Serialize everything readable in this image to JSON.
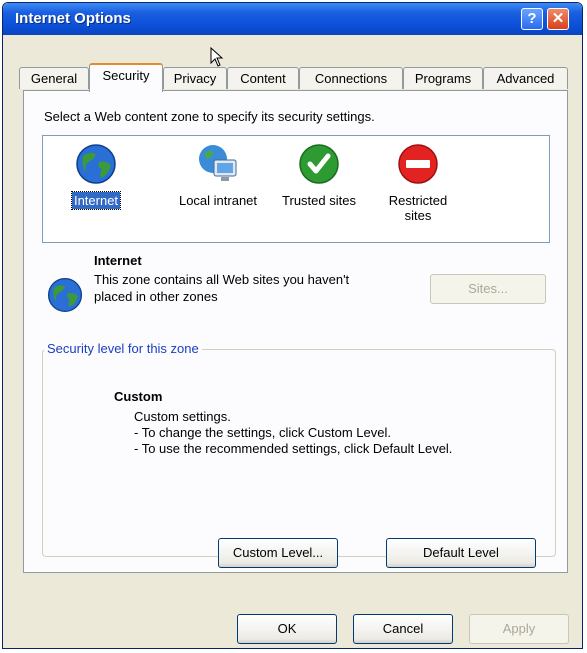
{
  "window": {
    "title": "Internet Options"
  },
  "tabs": [
    "General",
    "Security",
    "Privacy",
    "Content",
    "Connections",
    "Programs",
    "Advanced"
  ],
  "zones": {
    "prompt": "Select a Web content zone to specify its security settings.",
    "items": [
      {
        "label": "Internet",
        "icon": "globe-icon",
        "selected": true
      },
      {
        "label": "Local intranet",
        "icon": "intranet-icon",
        "selected": false
      },
      {
        "label": "Trusted sites",
        "icon": "trusted-check-icon",
        "selected": false
      },
      {
        "label": "Restricted sites",
        "icon": "restricted-icon",
        "selected": false
      }
    ]
  },
  "info": {
    "title": "Internet",
    "desc": "This zone contains all Web sites you haven't placed in other zones",
    "sites_label": "Sites..."
  },
  "security": {
    "legend": "Security level for this zone",
    "level_title": "Custom",
    "line1": "Custom settings.",
    "line2": "- To change the settings, click Custom Level.",
    "line3": "- To use the recommended settings, click Default Level.",
    "custom_level": "Custom Level...",
    "default_level": "Default Level"
  },
  "footer": {
    "ok": "OK",
    "cancel": "Cancel",
    "apply": "Apply"
  },
  "colors": {
    "titlebar": "#0b50d8",
    "selection": "#316ac5",
    "tab_highlight": "#e68b2c"
  }
}
